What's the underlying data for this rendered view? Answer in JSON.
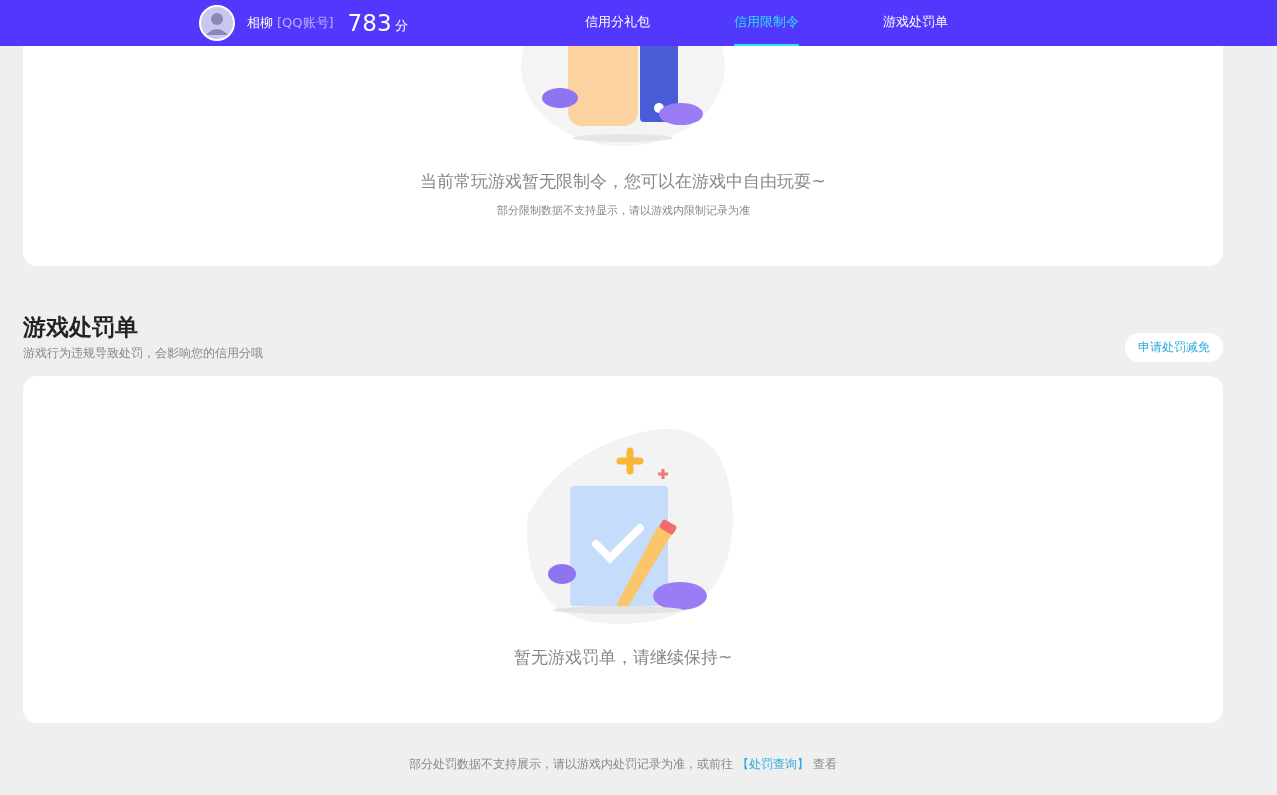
{
  "header": {
    "user_name": "相柳",
    "account_type": "[QQ账号]",
    "score": "783",
    "score_unit": "分"
  },
  "tabs": [
    {
      "label": "信用分礼包",
      "selected": false
    },
    {
      "label": "信用限制令",
      "selected": true
    },
    {
      "label": "游戏处罚单",
      "selected": false
    }
  ],
  "restriction_card": {
    "message": "当前常玩游戏暂无限制令，您可以在游戏中自由玩耍~",
    "note": "部分限制数据不支持显示，请以游戏内限制记录为准"
  },
  "penalty_section": {
    "title": "游戏处罚单",
    "subtitle": "游戏行为违规导致处罚，会影响您的信用分哦",
    "action_button": "申请处罚减免",
    "empty_message": "暂无游戏罚单，请继续保持~"
  },
  "footer": {
    "text": "部分处罚数据不支持展示，请以游戏内处罚记录为准，或前往",
    "link": "【处罚查询】",
    "suffix": "查看"
  }
}
